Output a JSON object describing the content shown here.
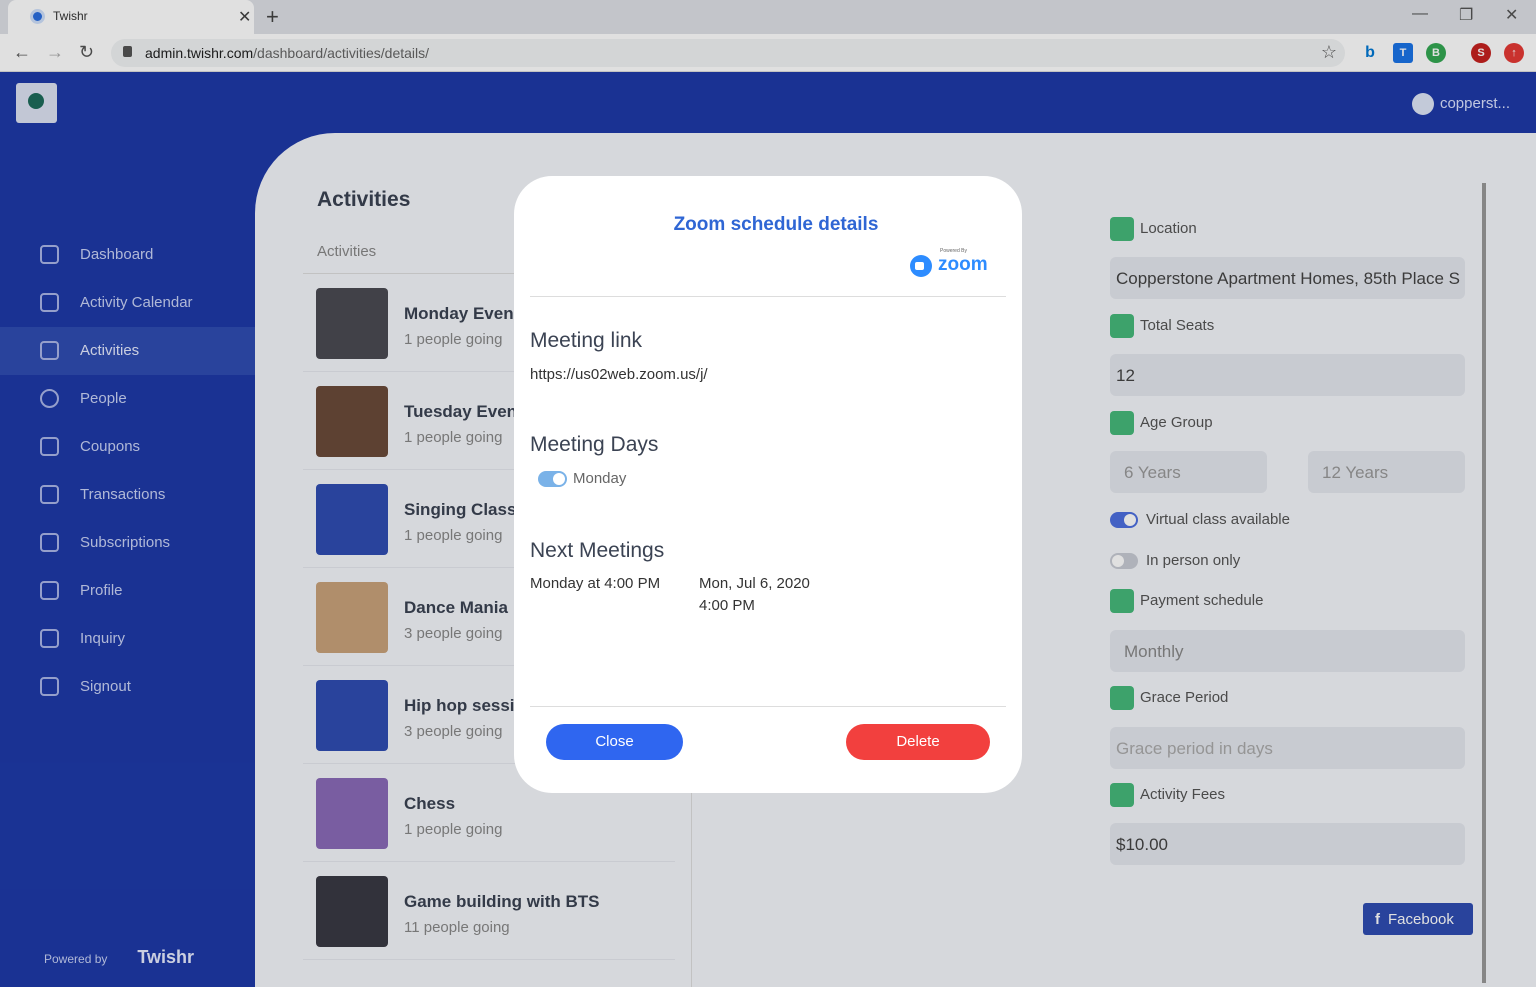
{
  "browser": {
    "tab_title": "Twishr",
    "url_host": "admin.twishr.com",
    "url_path": "/dashboard/activities/details/",
    "profile_initial": "S"
  },
  "header": {
    "username": "copperst..."
  },
  "sidebar": {
    "items": [
      {
        "label": "Dashboard"
      },
      {
        "label": "Activity Calendar"
      },
      {
        "label": "Activities"
      },
      {
        "label": "People"
      },
      {
        "label": "Coupons"
      },
      {
        "label": "Transactions"
      },
      {
        "label": "Subscriptions"
      },
      {
        "label": "Profile"
      },
      {
        "label": "Inquiry"
      },
      {
        "label": "Signout"
      }
    ],
    "powered_by": "Powered by",
    "brand": "Twishr"
  },
  "main": {
    "title": "Activities",
    "list_header": "Activities",
    "activities": [
      {
        "title": "Monday Eveni",
        "going": "1 people going"
      },
      {
        "title": "Tuesday Eveni",
        "going": "1 people going"
      },
      {
        "title": "Singing Class",
        "going": "1 people going"
      },
      {
        "title": "Dance Mania",
        "going": "3 people going"
      },
      {
        "title": "Hip hop sessio",
        "going": "3 people going"
      },
      {
        "title": "Chess",
        "going": "1 people going"
      },
      {
        "title": "Game building with BTS",
        "going": "11 people going"
      }
    ]
  },
  "details": {
    "location_label": "Location",
    "location_value": "Copperstone Apartment Homes, 85th Place S",
    "seats_label": "Total Seats",
    "seats_value": "12",
    "age_label": "Age Group",
    "age_min": "6 Years",
    "age_max": "12 Years",
    "virtual_label": "Virtual class available",
    "inperson_label": "In person only",
    "payment_label": "Payment schedule",
    "payment_value": "Monthly",
    "grace_label": "Grace Period",
    "grace_placeholder": "Grace period in days",
    "fees_label": "Activity Fees",
    "fees_value": "$10.00",
    "facebook_label": "Facebook"
  },
  "modal": {
    "title": "Zoom schedule details",
    "zoom_powered": "Powered By",
    "zoom_word": "zoom",
    "link_heading": "Meeting link",
    "link": "https://us02web.zoom.us/j/",
    "days_heading": "Meeting Days",
    "day": "Monday",
    "next_heading": "Next Meetings",
    "schedule": "Monday at 4:00 PM",
    "next_date": "Mon, Jul 6, 2020",
    "next_time": "4:00 PM",
    "close_label": "Close",
    "delete_label": "Delete"
  }
}
